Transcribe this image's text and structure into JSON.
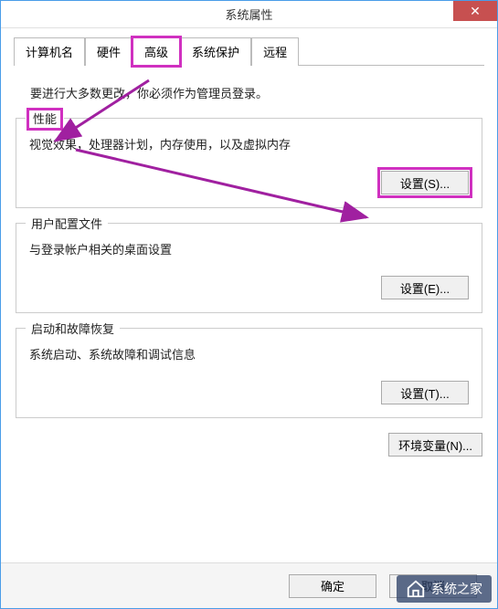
{
  "window": {
    "title": "系统属性",
    "close_glyph": "✕"
  },
  "tabs": {
    "items": [
      "计算机名",
      "硬件",
      "高级",
      "系统保护",
      "远程"
    ],
    "active_index": 2
  },
  "admin_note": "要进行大多数更改，你必须作为管理员登录。",
  "groups": {
    "performance": {
      "title": "性能",
      "desc": "视觉效果，处理器计划，内存使用，以及虚拟内存",
      "button": "设置(S)..."
    },
    "user_profiles": {
      "title": "用户配置文件",
      "desc": "与登录帐户相关的桌面设置",
      "button": "设置(E)..."
    },
    "startup_recovery": {
      "title": "启动和故障恢复",
      "desc": "系统启动、系统故障和调试信息",
      "button": "设置(T)..."
    }
  },
  "env_button": "环境变量(N)...",
  "footer": {
    "ok": "确定",
    "cancel": "取消"
  },
  "annotations": {
    "highlight_color": "#d030c0"
  },
  "watermark": {
    "text": "系统之家"
  }
}
